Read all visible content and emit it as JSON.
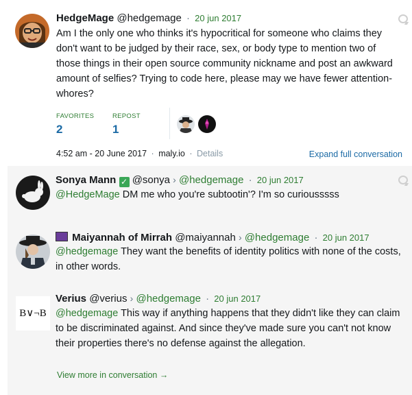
{
  "main_post": {
    "name": "HedgeMage",
    "handle": "@hedgemage",
    "date": "20 jun 2017",
    "text": "Am I the only one who thinks it's hypocritical for someone who claims they don't want to be judged by their race, sex, or body type to mention two of those things in their open source community nickname and post an awkward amount of selfies? Trying to code here, please may we have fewer attention-whores?",
    "favorites_label": "FAVORITES",
    "favorites_count": "2",
    "repost_label": "REPOST",
    "repost_count": "1",
    "timestamp": "4:52 am - 20 June 2017",
    "source": "maly.io",
    "details": "Details",
    "expand": "Expand full conversation"
  },
  "replies": [
    {
      "name": "Sonya Mann",
      "handle": "@sonya",
      "reply_to": "@hedgemage",
      "date": "20 jun 2017",
      "mention": "@HedgeMage",
      "text": " DM me who you're subtootin'? I'm so curiousssss"
    },
    {
      "name": "Maiyannah of Mirrah",
      "handle": "@maiyannah",
      "reply_to": "@hedgemage",
      "date": "20 jun 2017",
      "mention": "@hedgemage",
      "text": " They want the benefits of identity politics with none of the costs, in other words."
    },
    {
      "name": "Verius",
      "handle": "@verius",
      "reply_to": "@hedgemage",
      "date": "20 jun 2017",
      "mention": "@hedgemage",
      "text": " This way if anything happens that they didn't like they can claim to be discriminated against. And since they've made sure you can't not know their properties there's no defense against the allegation.",
      "avatar_text": "B∨¬B"
    }
  ],
  "separators": {
    "dot": "·",
    "chevron": "›",
    "check": "✓"
  },
  "view_more": "View more in conversation →",
  "colors": {
    "link_blue": "#1b6aa5",
    "mention_green": "#2e7d32",
    "conversation_bg": "#f5f5f5"
  }
}
